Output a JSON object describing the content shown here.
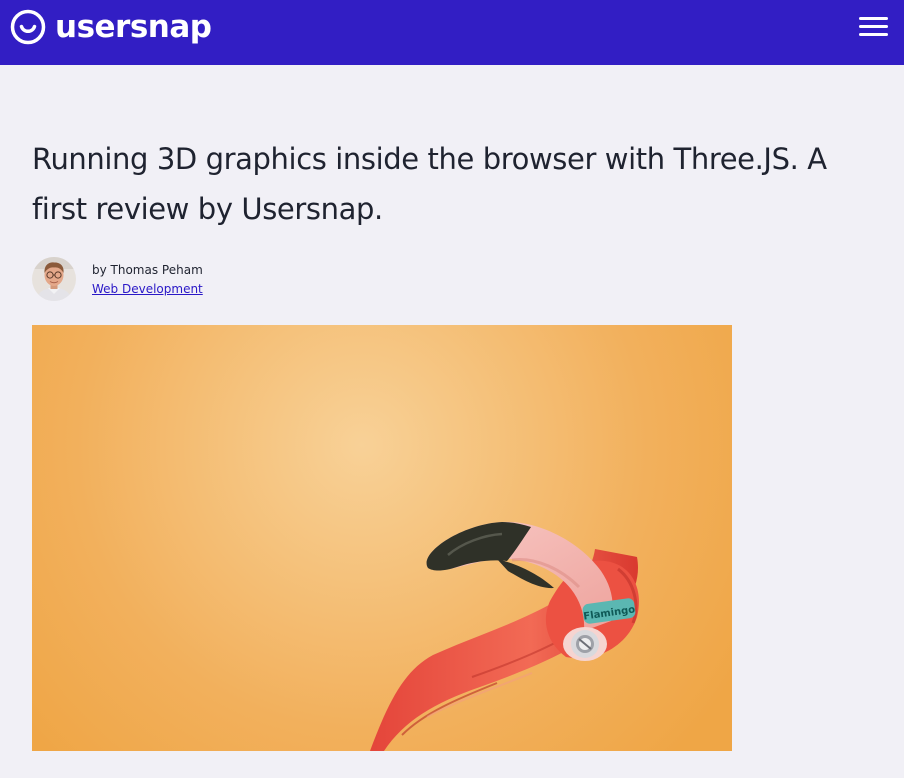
{
  "brand": {
    "name": "usersnap",
    "color": "#321ec4"
  },
  "nav": {
    "menu_icon": "hamburger-menu-icon"
  },
  "article": {
    "title": "Running 3D graphics inside the browser with Three.JS. A first review by Usersnap.",
    "byline": "by Thomas Peham",
    "category": "Web Development",
    "hero_image": {
      "subject": "3D flamingo head on orange background",
      "badge_text": "Flamingo"
    }
  },
  "colors": {
    "page_bg": "#f1f0f6",
    "text": "#1f2330",
    "link": "#2a18c7",
    "hero_orange": "#f0aa4e"
  }
}
